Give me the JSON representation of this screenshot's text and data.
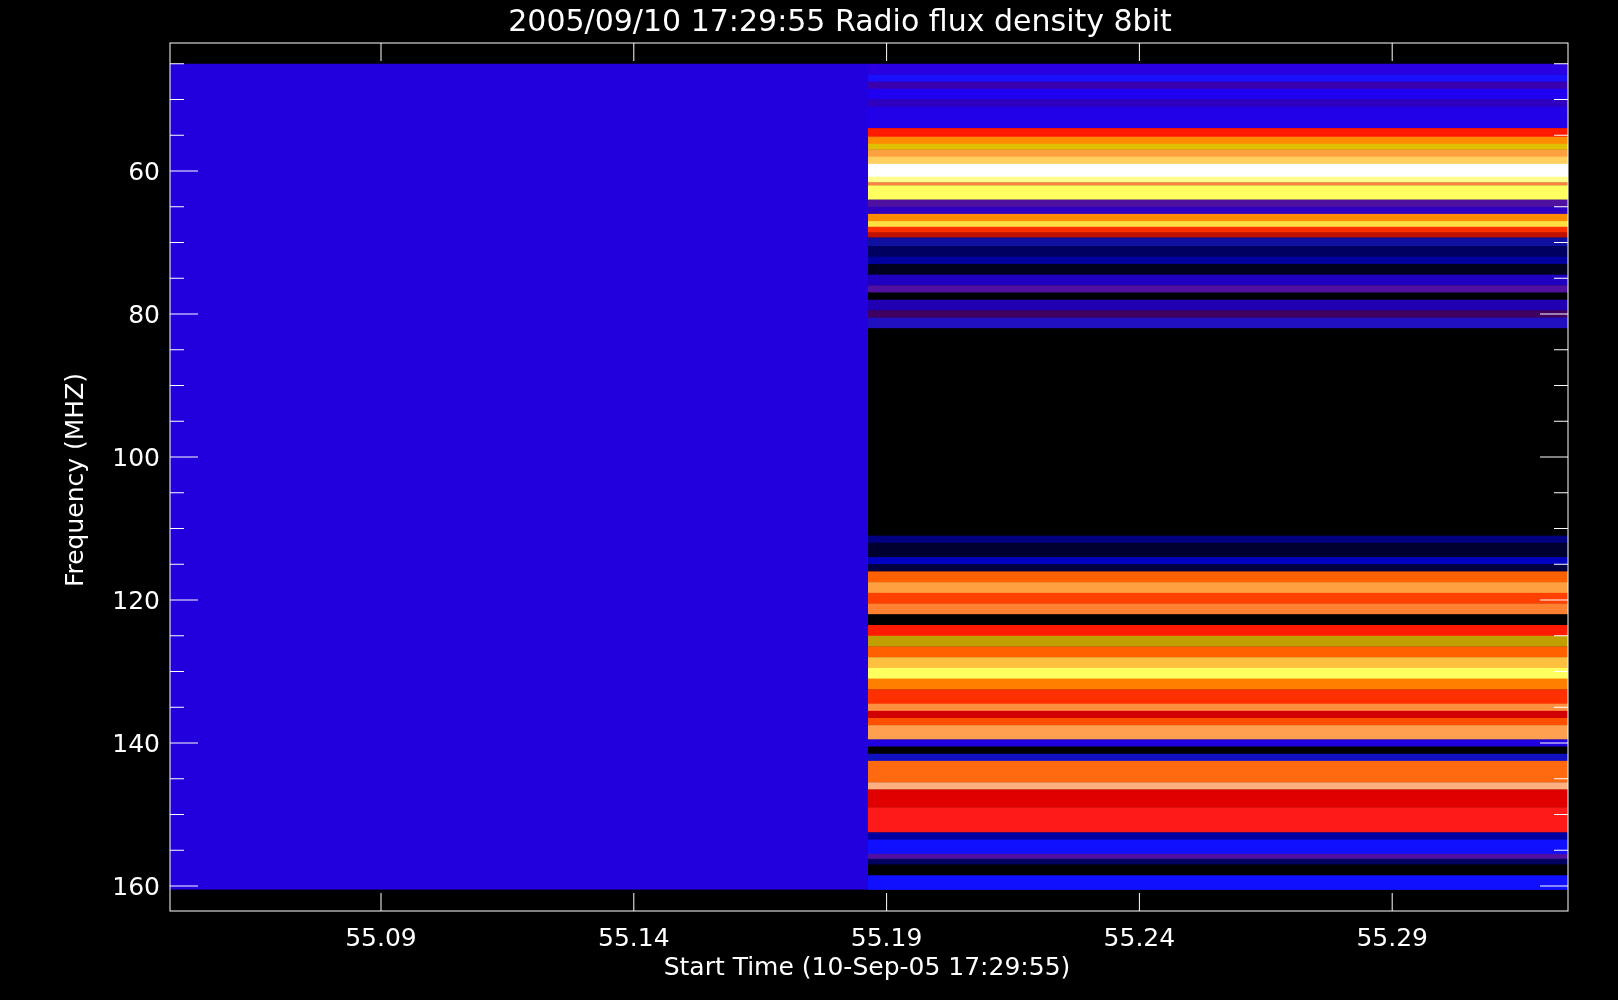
{
  "title": "2005/09/10 17:29:55 Radio flux density 8bit",
  "plot": {
    "ylabel": "Frequency (MHZ)",
    "xlabel": "Start Time (10-Sep-05 17:29:55)",
    "yticks": [
      "60",
      "80",
      "100",
      "120",
      "140",
      "160"
    ],
    "xticks": [
      "55.09",
      "55.14",
      "55.19",
      "55.24",
      "55.29"
    ]
  }
}
